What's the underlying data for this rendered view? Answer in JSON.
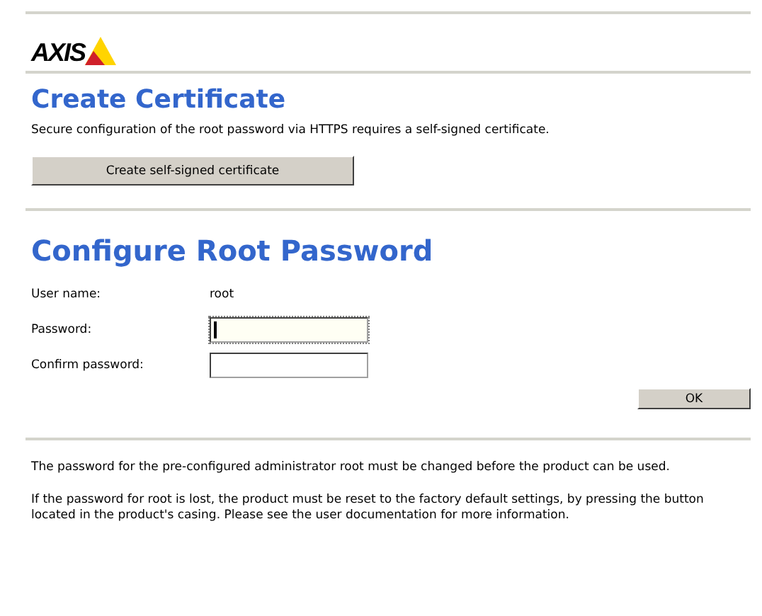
{
  "logo": {
    "text": "AXIS"
  },
  "certificate": {
    "title": "Create Certificate",
    "description": "Secure configuration of the root password via HTTPS requires a self-signed certificate.",
    "button": "Create self-signed certificate"
  },
  "password": {
    "title": "Configure Root Password",
    "fields": [
      {
        "kind": "text",
        "label": "User name:",
        "value": "root"
      },
      {
        "kind": "input",
        "label": "Password:",
        "focused": true
      },
      {
        "kind": "input",
        "label": "Confirm password:",
        "focused": false
      }
    ],
    "button": "OK"
  },
  "notes": [
    "The password for the pre-configured administrator root must be changed before the product can be used.",
    "If the password for root is lost, the product must be reset to the factory default settings, by pressing the button located in the product's casing. Please see the user documentation for more information."
  ]
}
